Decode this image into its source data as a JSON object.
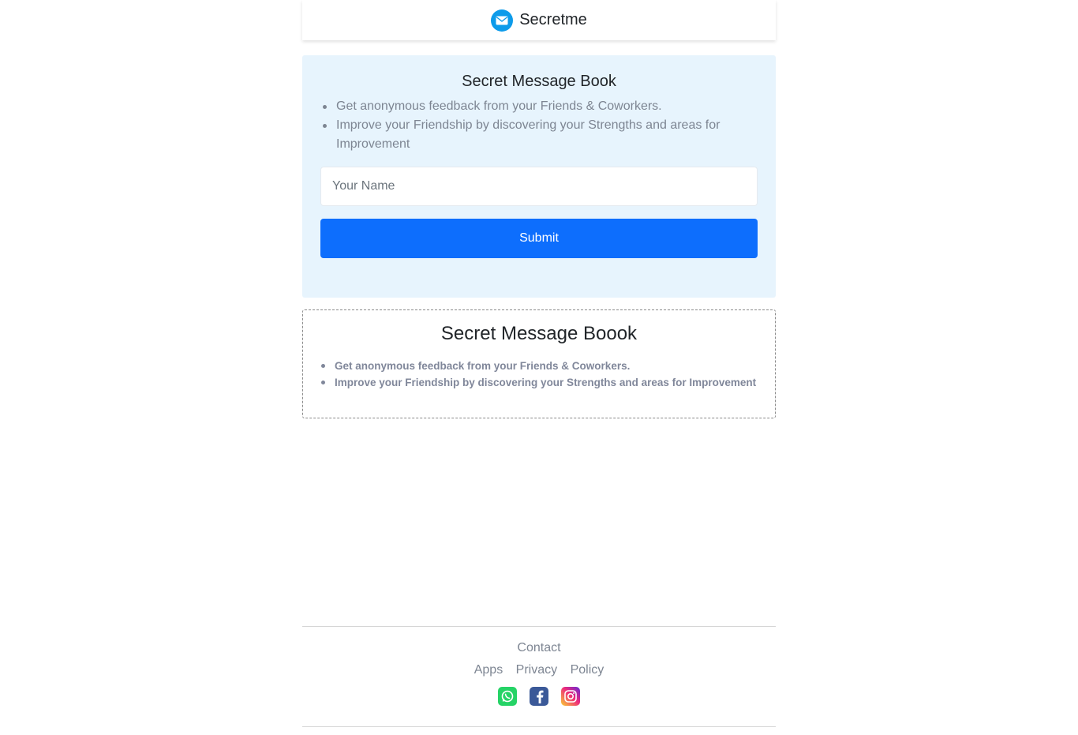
{
  "header": {
    "brand_name": "Secretme",
    "icon": "envelope-icon"
  },
  "form_card": {
    "title": "Secret Message Book",
    "bullets": [
      "Get anonymous feedback from your Friends & Coworkers.",
      "Improve your Friendship by discovering your Strengths and areas for Improvement"
    ],
    "name_input": {
      "placeholder": "Your Name",
      "value": ""
    },
    "submit_label": "Submit"
  },
  "info_card": {
    "title": "Secret Message Boook",
    "bullets": [
      "Get anonymous feedback from your Friends & Coworkers.",
      "Improve your Friendship by discovering your Strengths and areas for Improvement"
    ]
  },
  "footer": {
    "contact": "Contact",
    "links": [
      "Apps",
      "Privacy",
      "Policy"
    ],
    "social": [
      "whatsapp-icon",
      "facebook-icon",
      "instagram-icon"
    ]
  },
  "colors": {
    "accent": "#0d6efd",
    "card_bg": "#e7f4fd",
    "brand_icon": "#0d9bea",
    "muted_text": "#7d8592"
  }
}
